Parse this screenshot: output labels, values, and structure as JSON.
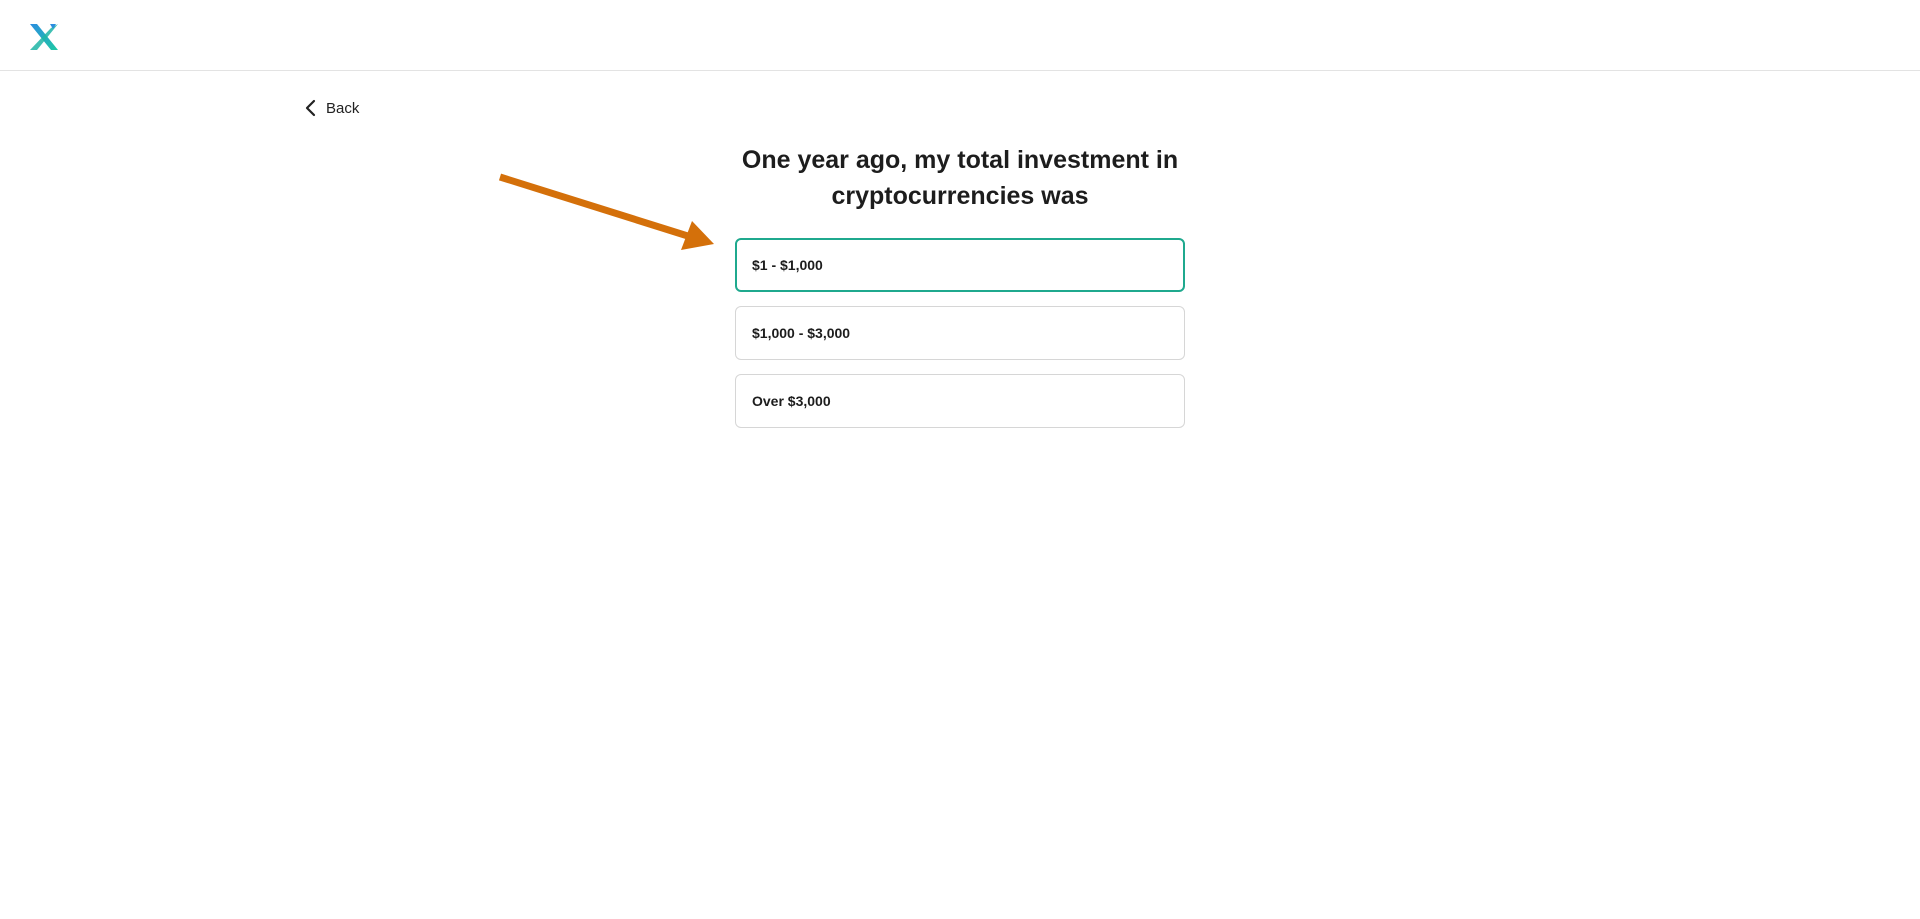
{
  "header": {
    "logo_icon": "x-logo-icon",
    "logo_colors": {
      "primary": "#1fb5a6",
      "secondary": "#2b8de0"
    }
  },
  "nav": {
    "back_label": "Back",
    "back_icon": "chevron-left-icon"
  },
  "question": {
    "title": "One year ago, my total investment in cryptocurrencies was"
  },
  "options": [
    {
      "label": "$1 - $1,000",
      "selected": true
    },
    {
      "label": "$1,000 - $3,000",
      "selected": false
    },
    {
      "label": "Over $3,000",
      "selected": false
    }
  ],
  "annotation": {
    "arrow_icon": "arrow-pointer-annotation",
    "arrow_color": "#d4700a"
  },
  "colors": {
    "selected_border": "#1fa98e",
    "default_border": "#d6d6d6"
  }
}
